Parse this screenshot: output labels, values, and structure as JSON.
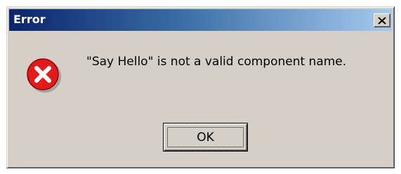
{
  "window": {
    "title": "Error",
    "close_icon": "close-x-icon"
  },
  "content": {
    "icon": "error-icon",
    "message": "\"Say Hello\" is not a valid component name."
  },
  "buttons": {
    "ok_label": "OK"
  },
  "colors": {
    "dialog_face": "#d4d0c8",
    "titlebar_start": "#0a246a",
    "titlebar_end": "#a6caf0",
    "error_red": "#e21a1a"
  }
}
